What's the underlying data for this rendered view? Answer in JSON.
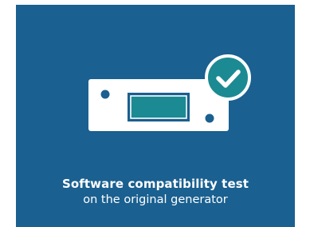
{
  "card": {
    "title": "Software compatibility test",
    "subtitle": "on the original generator",
    "device_icon": "generator-device-icon",
    "badge_icon": "check-circle-icon",
    "colors": {
      "background": "#1a6090",
      "device": "#ffffff",
      "screen": "#1c8a92",
      "badge": "#1c8a92",
      "check": "#ffffff"
    }
  }
}
